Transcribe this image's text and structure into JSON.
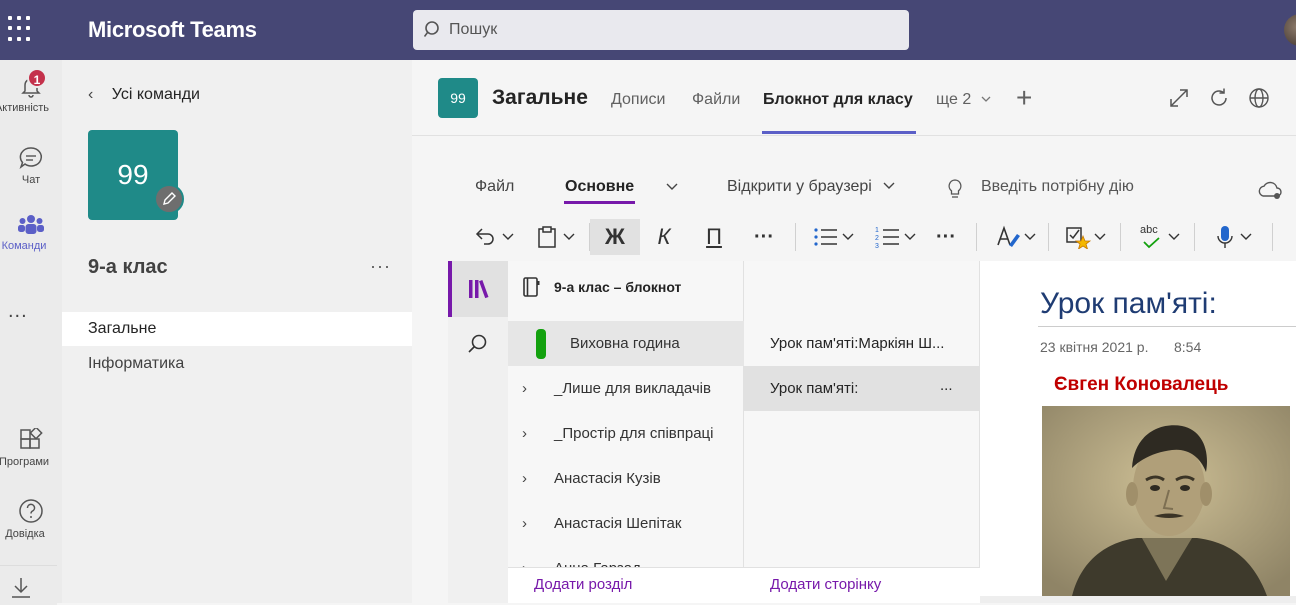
{
  "app": {
    "title": "Microsoft Teams",
    "search_placeholder": "Пошук"
  },
  "rail": {
    "activity_label": "Активність",
    "activity_badge": "1",
    "chat_label": "Чат",
    "teams_label": "Команди",
    "more_label": "...",
    "apps_label": "Програми",
    "help_label": "Довідка"
  },
  "sidepanel": {
    "back_label": "Усі команди",
    "team_tile": "99",
    "team_name": "9-а клас",
    "more": "···",
    "channels": [
      {
        "label": "Загальне",
        "active": true
      },
      {
        "label": "Інформатика",
        "active": false
      }
    ]
  },
  "channel": {
    "tile": "99",
    "name": "Загальне",
    "tabs": [
      {
        "label": "Дописи"
      },
      {
        "label": "Файли"
      },
      {
        "label": "Блокнот для класу",
        "active": true
      },
      {
        "label": "ще 2"
      }
    ]
  },
  "ribbon": {
    "tabs": [
      "Файл",
      "Основне"
    ],
    "open_in_browser": "Відкрити у браузері",
    "tell_me": "Введіть потрібну дію",
    "bold": "Ж",
    "italic": "К",
    "underline": "П",
    "more": "···",
    "spell": "abc"
  },
  "notebook": {
    "title": "9-а клас – блокнот",
    "sections": [
      {
        "label": "Виховна година",
        "active": true
      },
      {
        "label": "_Лише для викладачів"
      },
      {
        "label": "_Простір для співпраці"
      },
      {
        "label": "Анастасія Кузів"
      },
      {
        "label": "Анастасія Шепітак"
      },
      {
        "label": "Анна Гарзад"
      }
    ],
    "add_section": "Додати розділ",
    "pages": [
      {
        "label": "Урок пам'яті:Маркіян Ш..."
      },
      {
        "label": "Урок пам'яті:",
        "active": true,
        "more": "..."
      }
    ],
    "add_page": "Додати сторінку"
  },
  "page": {
    "title": "Урок пам'яті:",
    "date": "23 квітня 2021 р.",
    "time": "8:54",
    "subtitle": "Євген Коновалець"
  },
  "colors": {
    "topbar": "#464775",
    "accent": "#5b5fc7",
    "onenote": "#7719aa",
    "team_tile": "#1f8a88",
    "badge": "#c4314b",
    "subtitle": "#c00000"
  }
}
